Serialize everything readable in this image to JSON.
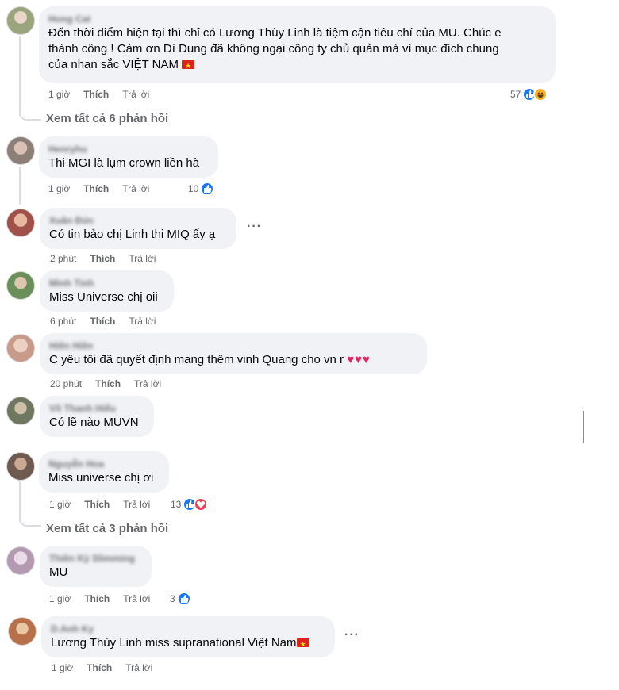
{
  "comments": [
    {
      "name": "Hong Cat",
      "text_lines": [
        "Đến thời điểm hiện tại thì chỉ có Lương Thùy Linh là tiệm cận tiêu chí của MU. Chúc e",
        "thành công ! Cảm ơn Dì Dung đã không ngại công ty chủ quản mà vì mục đích chung",
        "của nhan sắc VIỆT NAM"
      ],
      "time": "1 giờ",
      "like": "Thích",
      "reply": "Trả lời",
      "reactions": "57",
      "view_replies": "Xem tất cả 6 phản hồi",
      "avatar_color": "#9aa57d"
    },
    {
      "name": "Henryhu",
      "text": "Thi MGI là lụm crown liền hà",
      "time": "1 giờ",
      "like": "Thích",
      "reply": "Trả lời",
      "reactions": "10",
      "avatar_color": "#8c7f78"
    },
    {
      "name": "Xuân Đức",
      "text": "Có tin bảo chị Linh thi MIQ ấy ạ",
      "time": "2 phút",
      "like": "Thích",
      "reply": "Trả lời",
      "more": "···",
      "avatar_color": "#a0524a"
    },
    {
      "name": "Minh Tinh",
      "text": "Miss Universe chị oii",
      "time": "6 phút",
      "like": "Thích",
      "reply": "Trả lời",
      "avatar_color": "#6b8f5a"
    },
    {
      "name": "Hiền Hiền",
      "text": "C yêu tôi đã quyết định mang thêm vinh Quang cho vn r",
      "hearts": "♥♥♥",
      "time": "20 phút",
      "like": "Thích",
      "reply": "Trả lời",
      "avatar_color": "#c89a8a"
    },
    {
      "name": "Võ Thanh Hiếu",
      "text": "Có lẽ nào MUVN",
      "time": "",
      "like": "",
      "reply": "",
      "avatar_color": "#707760"
    },
    {
      "name": "Nguyễn Hoa",
      "text": "Miss universe chị ơi",
      "time": "1 giờ",
      "like": "Thích",
      "reply": "Trả lời",
      "reactions": "13",
      "view_replies": "Xem tất cả 3 phản hồi",
      "avatar_color": "#6e5a4e"
    },
    {
      "name": "Thiên Kỳ Slimming",
      "text": "MU",
      "time": "1 giờ",
      "like": "Thích",
      "reply": "Trả lời",
      "reactions": "3",
      "avatar_color": "#b49ab0"
    },
    {
      "name": "D.Anh Ky",
      "text": "Lương Thùy Linh miss supranational Việt Nam",
      "time": "1 giờ",
      "like": "Thích",
      "reply": "Trả lời",
      "more": "···",
      "avatar_color": "#b8704a"
    }
  ],
  "colors": {
    "bubble": "#f0f2f5",
    "like_blue": "#1877f2",
    "love_red": "#f33e58",
    "haha_yellow": "#f7b125",
    "meta_gray": "#65676b"
  },
  "icons": {
    "like": "thumbs-up-icon",
    "love": "heart-icon",
    "haha": "haha-icon",
    "flag": "vietnam-flag-icon",
    "more": "more-options-icon"
  }
}
